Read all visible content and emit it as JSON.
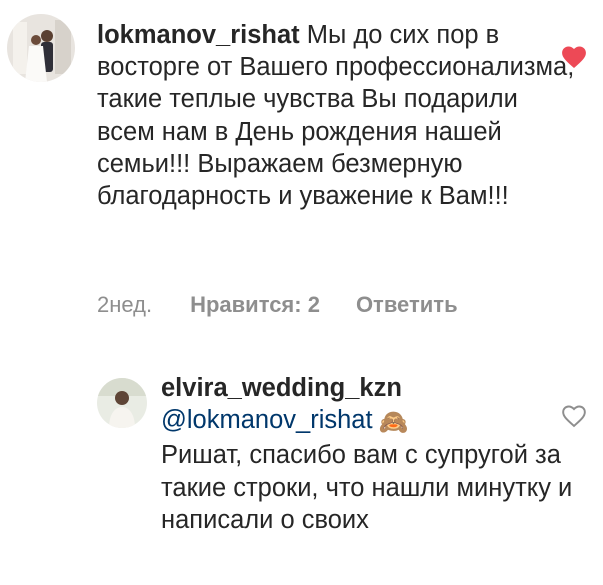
{
  "comments": [
    {
      "username": "lokmanov_rishat",
      "text": "Мы до сих пор в восторге от Вашего профессионализма, такие теплые чувства Вы подарили всем нам в День рождения нашей семьи!!! Выражаем безмерную благодарность и уважение к Вам!!!",
      "time": "2нед.",
      "likes": "Нравится: 2",
      "reply": "Ответить",
      "liked": true,
      "icon": "heart-filled-icon",
      "like_color": "#ed4956"
    },
    {
      "username": "elvira_wedding_kzn",
      "mention": "@lokmanov_rishat",
      "emoji": "🙈",
      "text": "Ришат, спасибо вам с супругой за такие строки, что нашли минутку и написали о своих",
      "liked": false,
      "icon": "heart-outline-icon",
      "mention_color": "#00376b"
    }
  ]
}
